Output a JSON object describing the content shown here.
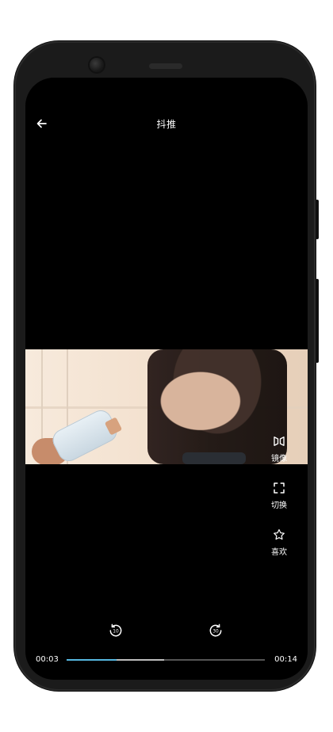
{
  "header": {
    "title": "抖推"
  },
  "player": {
    "current_time": "00:03",
    "total_time": "00:14",
    "progress_fraction": 0.25,
    "buffered_fraction": 0.49,
    "accent_color": "#56b7e0"
  },
  "side_controls": {
    "mirror": {
      "label": "镜像",
      "icon": "mirror-icon"
    },
    "switch": {
      "label": "切换",
      "icon": "fullscreen-icon"
    },
    "favorite": {
      "label": "喜欢",
      "icon": "star-icon"
    }
  },
  "skip": {
    "back_seconds": "10",
    "forward_seconds": "30"
  }
}
